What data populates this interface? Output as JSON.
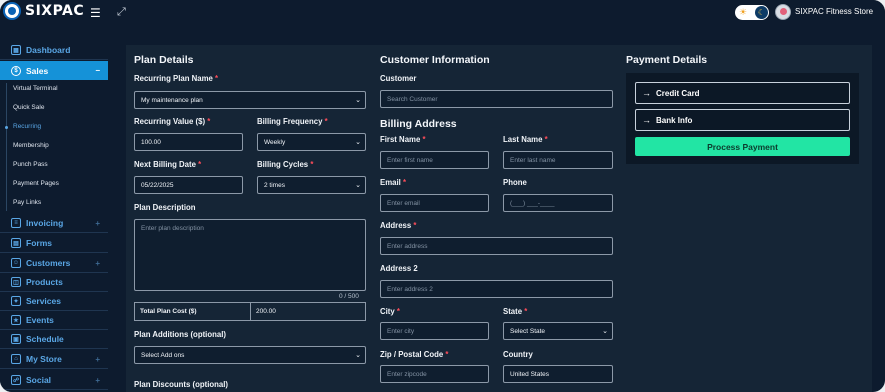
{
  "app": {
    "brand": "SIXPAC",
    "store_name": "SIXPAC Fitness Store"
  },
  "topbar": {
    "menu_icon": "hamburger-icon",
    "expand_icon": "expand-icon",
    "theme_toggle": "dark"
  },
  "sidebar": {
    "items": [
      {
        "label": "Dashboard",
        "icon": "dashboard-icon"
      },
      {
        "label": "Sales",
        "icon": "dollar-icon",
        "active": true
      },
      {
        "label": "Invoicing",
        "icon": "invoice-icon"
      },
      {
        "label": "Forms",
        "icon": "form-icon"
      },
      {
        "label": "Customers",
        "icon": "users-icon"
      },
      {
        "label": "Products",
        "icon": "box-icon"
      },
      {
        "label": "Services",
        "icon": "service-icon"
      },
      {
        "label": "Events",
        "icon": "star-icon"
      },
      {
        "label": "Schedule",
        "icon": "calendar-icon"
      },
      {
        "label": "My Store",
        "icon": "store-icon"
      },
      {
        "label": "Social",
        "icon": "social-icon"
      }
    ],
    "sales_sub": [
      "Virtual Terminal",
      "Quick Sale",
      "Recurring",
      "Membership",
      "Punch Pass",
      "Payment Pages",
      "Pay Links"
    ],
    "plus": "+",
    "minus": "−"
  },
  "plan": {
    "title": "Plan Details",
    "name_label": "Recurring Plan Name",
    "name_value": "My maintenance plan",
    "value_label": "Recurring Value ($)",
    "value_value": "100.00",
    "freq_label": "Billing Frequency",
    "freq_value": "Weekly",
    "next_label": "Next Billing Date",
    "next_value": "05/22/2025",
    "cycles_label": "Billing Cycles",
    "cycles_value": "2 times",
    "desc_label": "Plan Description",
    "desc_placeholder": "Enter plan description",
    "desc_count": "0 / 500",
    "cost_label": "Total Plan Cost ($)",
    "cost_value": "200.00",
    "additions_label": "Plan Additions (optional)",
    "additions_value": "Select Add ons",
    "discounts_label": "Plan Discounts (optional)"
  },
  "customer": {
    "title": "Customer Information",
    "customer_label": "Customer",
    "customer_placeholder": "Search Customer",
    "billing_title": "Billing Address",
    "first_label": "First Name",
    "first_placeholder": "Enter first name",
    "last_label": "Last Name",
    "last_placeholder": "Enter last name",
    "email_label": "Email",
    "email_placeholder": "Enter email",
    "phone_label": "Phone",
    "phone_placeholder": "(___) ___-____",
    "address_label": "Address",
    "address_placeholder": "Enter address",
    "address2_label": "Address 2",
    "address2_placeholder": "Enter address 2",
    "city_label": "City",
    "city_placeholder": "Enter city",
    "state_label": "State",
    "state_value": "Select State",
    "zip_label": "Zip / Postal Code",
    "zip_placeholder": "Enter zipcode",
    "country_label": "Country",
    "country_value": "United States"
  },
  "payment": {
    "title": "Payment Details",
    "credit_label": "Credit Card",
    "bank_label": "Bank Info",
    "process_label": "Process Payment"
  },
  "colors": {
    "accent": "#1592d8",
    "success": "#22e5a4",
    "required": "#ff4d5a",
    "background": "#0d1b2e"
  }
}
